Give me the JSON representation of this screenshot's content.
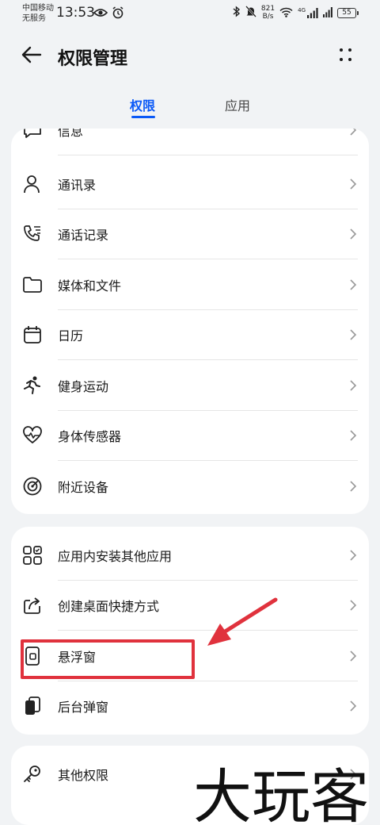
{
  "status_bar": {
    "carrier_line1": "中国移动",
    "carrier_line2": "无服务",
    "time": "13:53",
    "net_speed_value": "821",
    "net_speed_unit": "B/s",
    "network_type": "4G",
    "battery": "55",
    "icons": [
      "eye-icon",
      "alarm-icon",
      "bluetooth-icon",
      "mute-bell-icon",
      "wifi-icon",
      "signal-icon",
      "battery-icon"
    ]
  },
  "header": {
    "title": "权限管理"
  },
  "tabs": [
    {
      "label": "权限",
      "active": true
    },
    {
      "label": "应用",
      "active": false
    }
  ],
  "permissions_group": {
    "partial_item": {
      "label": "信息",
      "icon": "message-icon"
    },
    "items": [
      {
        "label": "通讯录",
        "icon": "contacts-icon"
      },
      {
        "label": "通话记录",
        "icon": "call-log-icon"
      },
      {
        "label": "媒体和文件",
        "icon": "folder-icon"
      },
      {
        "label": "日历",
        "icon": "calendar-icon"
      },
      {
        "label": "健身运动",
        "icon": "running-icon"
      },
      {
        "label": "身体传感器",
        "icon": "heart-rate-icon"
      },
      {
        "label": "附近设备",
        "icon": "nearby-icon"
      }
    ]
  },
  "special_group": {
    "items": [
      {
        "label": "应用内安装其他应用",
        "icon": "app-grid-icon"
      },
      {
        "label": "创建桌面快捷方式",
        "icon": "shortcut-icon"
      },
      {
        "label": "悬浮窗",
        "icon": "floating-window-icon"
      },
      {
        "label": "后台弹窗",
        "icon": "background-popup-icon"
      }
    ]
  },
  "other_group": {
    "items": [
      {
        "label": "其他权限",
        "icon": "key-icon"
      }
    ]
  },
  "annotations": {
    "highlight_color": "#e0323d",
    "watermark_text": "大玩客"
  },
  "colors": {
    "accent": "#0a59f7",
    "background": "#f1f3f5",
    "card": "#ffffff"
  }
}
